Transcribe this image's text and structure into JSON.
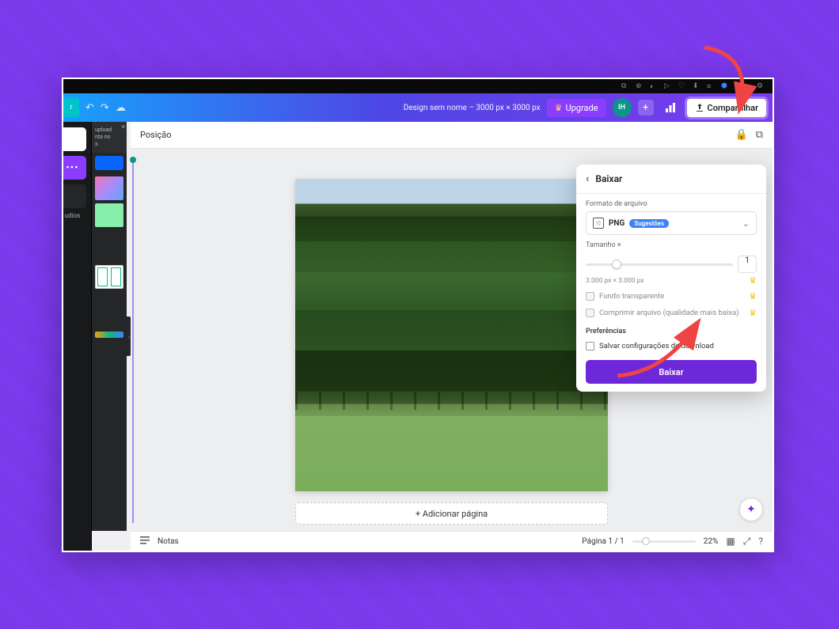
{
  "topbar": {
    "doc_title": "Design sem nome – 3000 px × 3000 px",
    "upgrade_label": "Upgrade",
    "avatar_initials": "IH",
    "share_label": "Compartilhar"
  },
  "sub_toolbar": {
    "position_label": "Posição"
  },
  "left_rail": {
    "section_label": "udios"
  },
  "tip_box": {
    "line1": "upload",
    "line2": "nta no",
    "line3": "x."
  },
  "canvas": {
    "add_page_label": "+ Adicionar página"
  },
  "footer": {
    "notes_label": "Notas",
    "page_label": "Página 1 / 1",
    "zoom_label": "22%"
  },
  "popover": {
    "title": "Baixar",
    "format_section": "Formato de arquivo",
    "format_value": "PNG",
    "format_badge": "Sugestões",
    "size_section": "Tamanho ×",
    "size_value": "1",
    "dimensions": "3.000 px × 3.000 px",
    "opt_transparent": "Fundo transparente",
    "opt_compress": "Comprimir arquivo (qualidade mais baixa)",
    "prefs_section": "Preferências",
    "opt_save_prefs": "Salvar configurações de download",
    "download_label": "Baixar"
  }
}
